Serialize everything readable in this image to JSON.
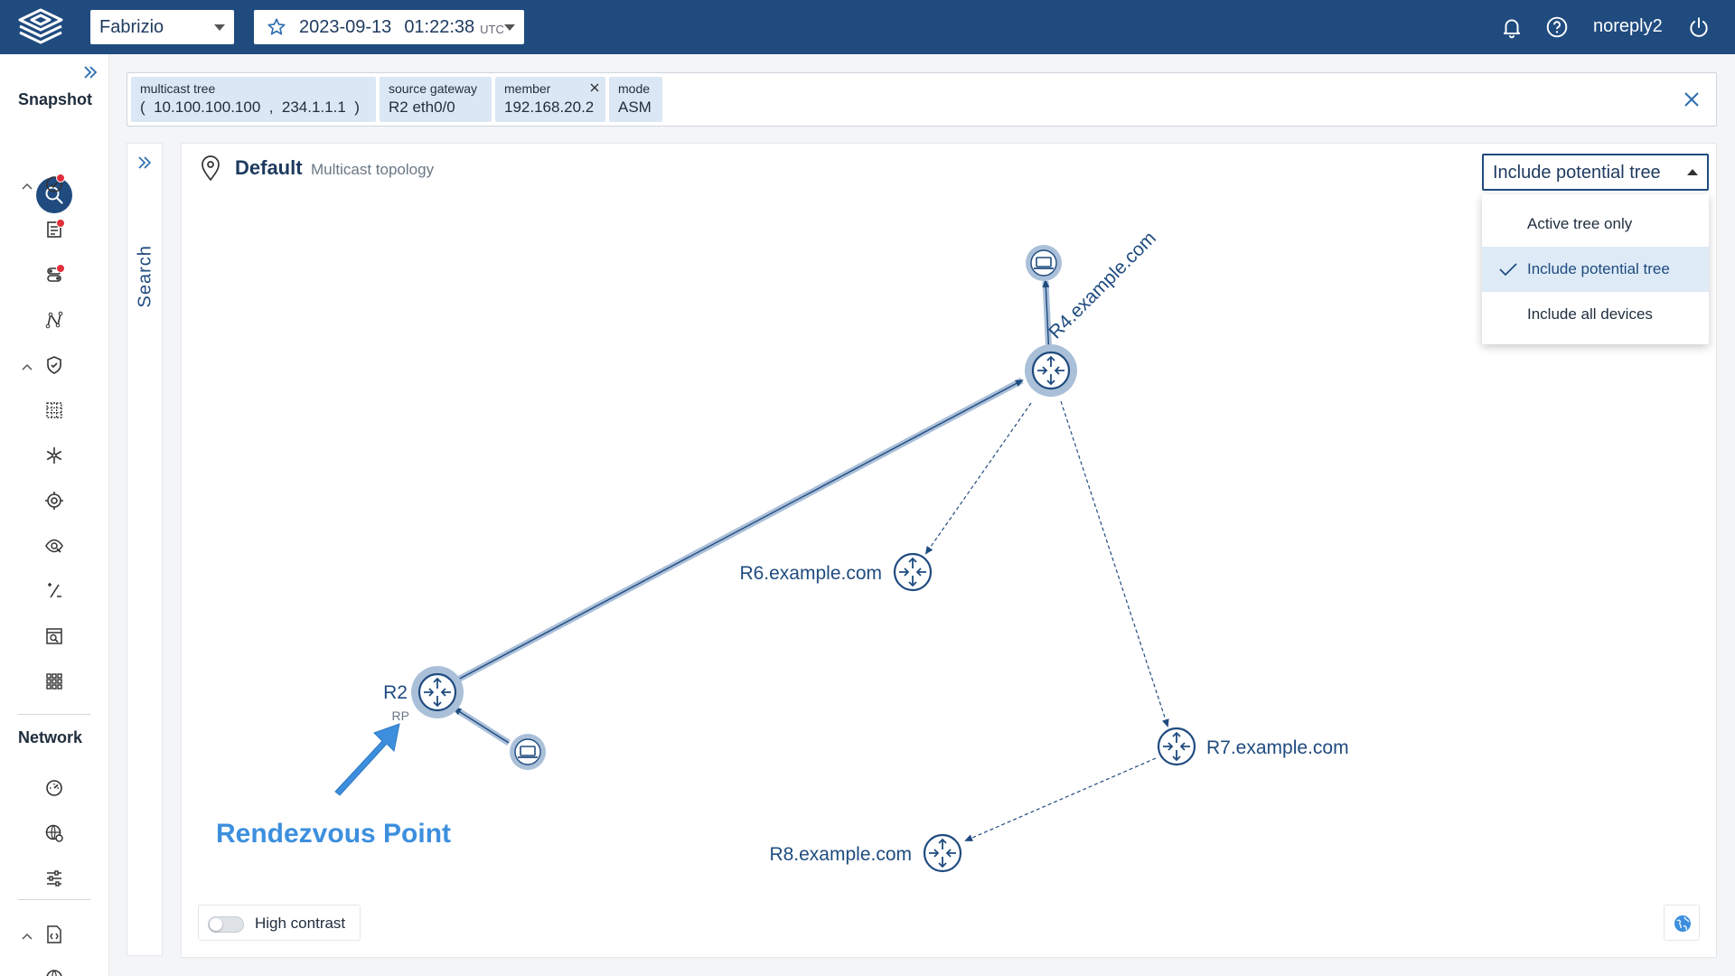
{
  "topbar": {
    "tenant": "Fabrizio",
    "snapshot_date": "2023-09-13",
    "snapshot_time": "01:22:38",
    "timezone": "UTC",
    "username": "noreply2"
  },
  "leftnav": {
    "section_snapshot": "Snapshot",
    "section_network": "Network"
  },
  "filters": [
    {
      "key": "multicast tree",
      "value": "(  10.100.100.100  ,  234.1.1.1  )"
    },
    {
      "key": "source gateway",
      "value": "R2 eth0/0"
    },
    {
      "key": "member",
      "value": "192.168.20.2"
    },
    {
      "key": "mode",
      "value": "ASM"
    }
  ],
  "search_label": "Search",
  "view": {
    "title": "Default",
    "subtitle": "Multicast topology"
  },
  "tree_dropdown": {
    "selected": "Include potential tree",
    "options": [
      "Active tree only",
      "Include potential tree",
      "Include all devices"
    ]
  },
  "topology": {
    "nodes": [
      {
        "label": "R4.example.com",
        "type": "router"
      },
      {
        "label": "R6.example.com",
        "type": "router"
      },
      {
        "label": "R2",
        "sublabel": "RP",
        "type": "router"
      },
      {
        "label": "R7.example.com",
        "type": "router"
      },
      {
        "label": "R8.example.com",
        "type": "router"
      }
    ],
    "annotation": "Rendezvous Point"
  },
  "high_contrast_label": "High contrast",
  "colors": {
    "topbar": "#1f4b7f",
    "accent": "#1f4b7f",
    "annotation": "#3d8fde",
    "badge": "#e0303a",
    "chip": "#dbe7f4"
  }
}
